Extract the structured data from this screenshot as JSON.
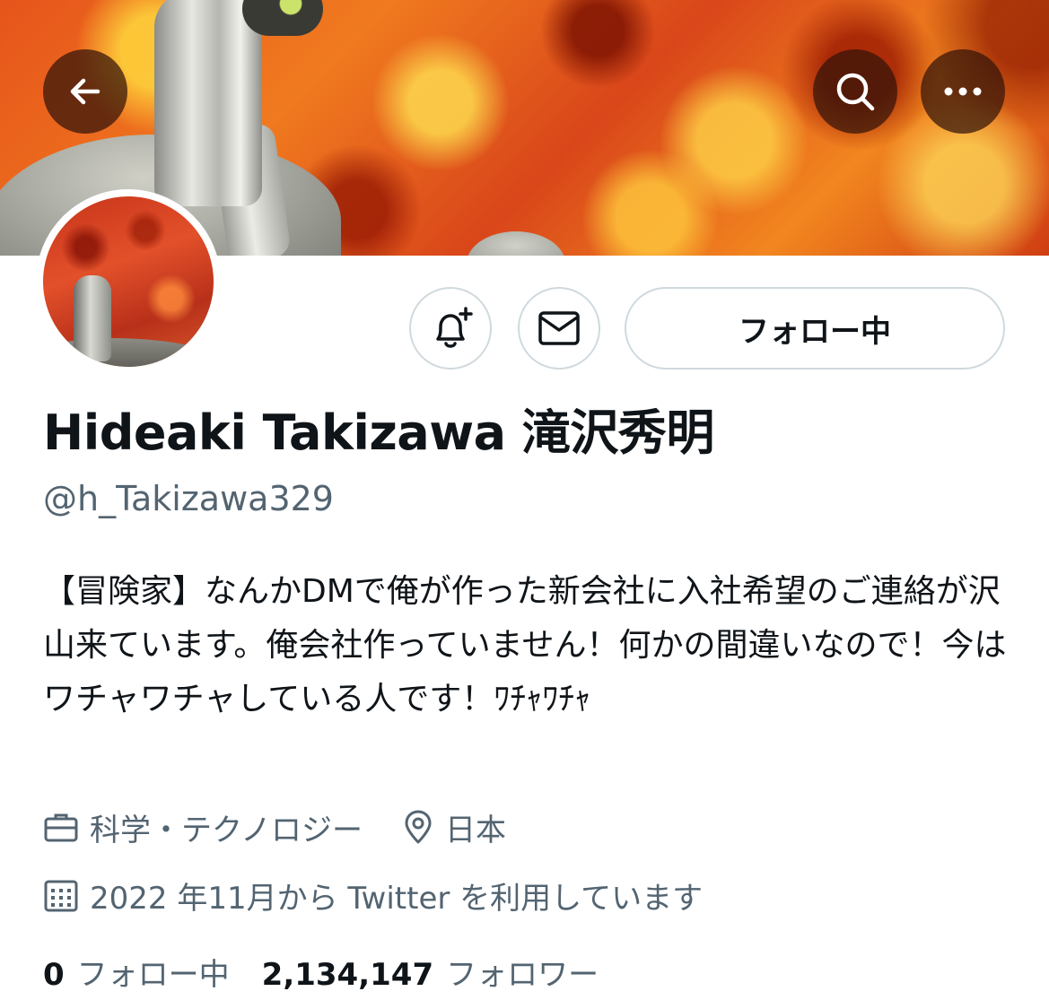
{
  "header": {
    "back_icon": "arrow-left-icon",
    "search_icon": "search-icon",
    "more_icon": "more-horizontal-icon"
  },
  "profile": {
    "display_name": "Hideaki Takizawa 滝沢秀明",
    "handle": "@h_Takizawa329",
    "bio": "【冒険家】なんかDMで俺が作った新会社に入社希望のご連絡が沢山来ています。俺会社作っていません！何かの間違いなので！今はワチャワチャしている人です！ﾜﾁｬﾜﾁｬ",
    "category": "科学・テクノロジー",
    "location": "日本",
    "joined": "2022 年11月から Twitter を利用しています"
  },
  "actions": {
    "notify_icon": "bell-plus-icon",
    "message_icon": "mail-icon",
    "follow_label": "フォロー中"
  },
  "stats": {
    "following_count": "0",
    "following_label": "フォロー中",
    "followers_count": "2,134,147",
    "followers_label": "フォロワー"
  },
  "colors": {
    "text": "#0f1419",
    "secondary": "#536471",
    "border": "#cfd9de"
  }
}
